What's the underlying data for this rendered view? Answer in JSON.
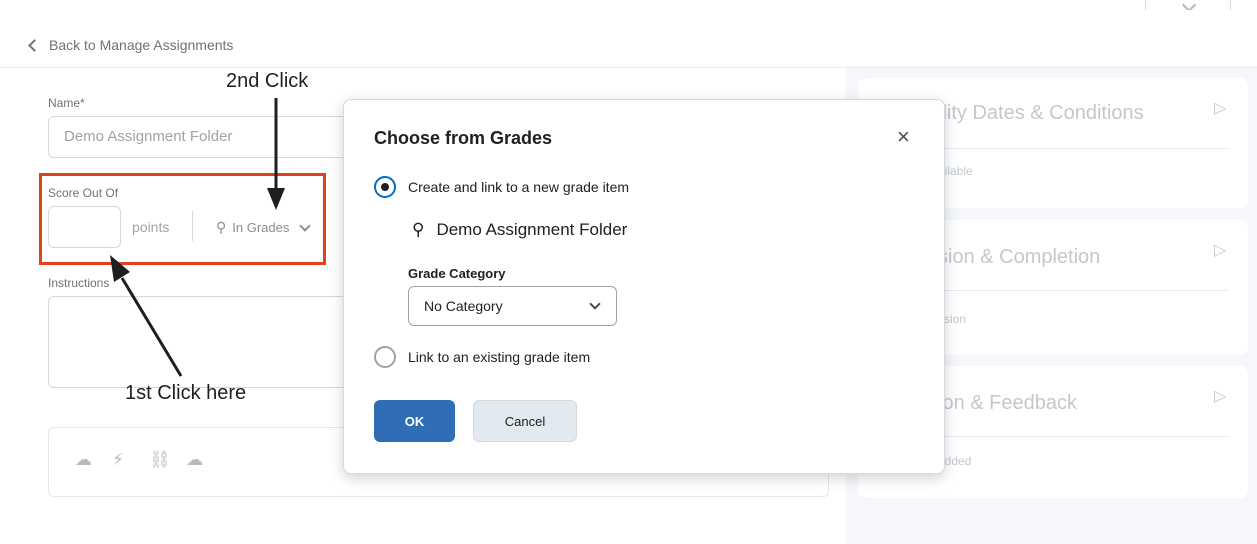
{
  "header": {
    "back_label": "Back to Manage Assignments"
  },
  "form": {
    "name_label": "Name*",
    "name_value": "Demo Assignment Folder",
    "score_label": "Score Out Of",
    "score_value": "",
    "points_label": "points",
    "in_grades_label": "In Grades",
    "instructions_label": "Instructions"
  },
  "sidebar": {
    "cards": [
      {
        "title": "ility Dates & Conditions",
        "sub": "ailable"
      },
      {
        "title": "sion & Completion",
        "sub": "ssion"
      },
      {
        "title": "ion & Feedback",
        "sub": "added"
      }
    ]
  },
  "modal": {
    "title": "Choose from Grades",
    "option_new": "Create and link to a new grade item",
    "grade_item_name": "Demo Assignment Folder",
    "category_label": "Grade Category",
    "category_value": "No Category",
    "option_existing": "Link to an existing grade item",
    "ok_label": "OK",
    "cancel_label": "Cancel",
    "selected_option": "new"
  },
  "annotations": {
    "first": "1st Click here",
    "second": "2nd Click"
  },
  "colors": {
    "highlight": "#e0431c",
    "primary": "#2f6db4"
  }
}
